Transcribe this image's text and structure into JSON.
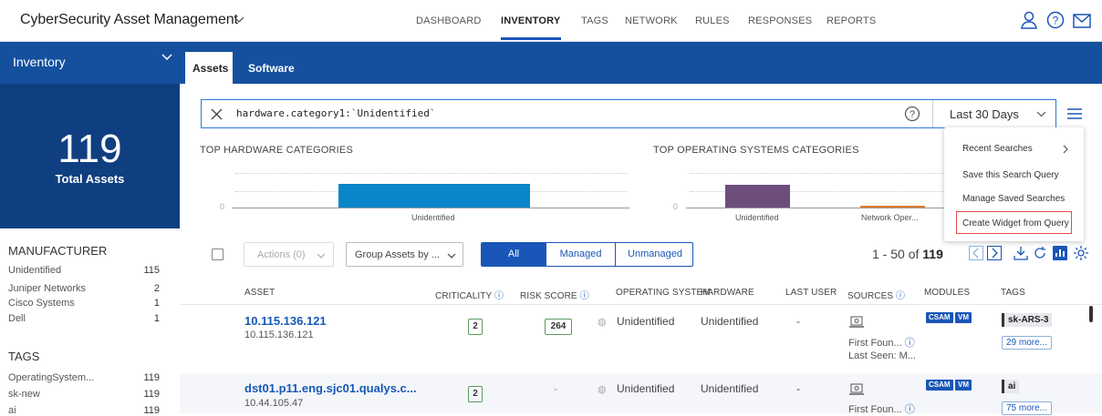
{
  "app": {
    "title": "CyberSecurity Asset Management"
  },
  "nav": {
    "items": [
      "DASHBOARD",
      "INVENTORY",
      "TAGS",
      "NETWORK",
      "RULES",
      "RESPONSES",
      "REPORTS"
    ],
    "active": "INVENTORY"
  },
  "sidebar": {
    "title": "Inventory",
    "total": "119",
    "total_label": "Total Assets",
    "manufacturer_heading": "MANUFACTURER",
    "manufacturers": [
      {
        "name": "Unidentified",
        "count": "115"
      },
      {
        "name": "Juniper Networks",
        "count": "2"
      },
      {
        "name": "Cisco Systems",
        "count": "1"
      },
      {
        "name": "Dell",
        "count": "1"
      }
    ],
    "tags_heading": "TAGS",
    "tags": [
      {
        "name": "OperatingSystem...",
        "count": "119"
      },
      {
        "name": "sk-new",
        "count": "119"
      },
      {
        "name": "ai",
        "count": "119"
      }
    ]
  },
  "tabs": {
    "assets": "Assets",
    "software": "Software"
  },
  "search": {
    "query": "hardware.category1:`Unidentified`",
    "range": "Last 30 Days"
  },
  "charts": {
    "hardware_title": "TOP HARDWARE CATEGORIES",
    "os_title": "TOP OPERATING SYSTEMS CATEGORIES",
    "zero": "0"
  },
  "chart_data": [
    {
      "type": "bar",
      "title": "TOP HARDWARE CATEGORIES",
      "categories": [
        "Unidentified"
      ],
      "values": [
        119
      ]
    },
    {
      "type": "bar",
      "title": "TOP OPERATING SYSTEMS CATEGORIES",
      "categories": [
        "Unidentified",
        "Network Oper..."
      ],
      "values": [
        115,
        4
      ]
    }
  ],
  "menu": {
    "items": [
      "Recent Searches",
      "Save this Search Query",
      "Manage Saved Searches",
      "Create Widget from Query"
    ]
  },
  "toolbar": {
    "actions": "Actions (0)",
    "group_by": "Group Assets by ...",
    "filters": [
      "All",
      "Managed",
      "Unmanaged"
    ],
    "pager_prefix": "1 - 50 of",
    "pager_total": "119"
  },
  "table": {
    "headers": [
      "ASSET",
      "CRITICALITY",
      "RISK SCORE",
      "OPERATING SYSTEM",
      "HARDWARE",
      "LAST USER",
      "SOURCES",
      "MODULES",
      "TAGS"
    ],
    "rows": [
      {
        "name": "10.115.136.121",
        "ip": "10.115.136.121",
        "criticality": "2",
        "risk": "264",
        "os": "Unidentified",
        "hardware": "Unidentified",
        "user": "-",
        "source1": "First Foun...",
        "source2": "Last Seen: M...",
        "modules": [
          "CSAM",
          "VM"
        ],
        "tag": "sk-ARS-3",
        "more": "29 more..."
      },
      {
        "name": "dst01.p11.eng.sjc01.qualys.c...",
        "ip": "10.44.105.47",
        "criticality": "2",
        "risk": "-",
        "os": "Unidentified",
        "hardware": "Unidentified",
        "user": "-",
        "source1": "First Foun...",
        "modules": [
          "CSAM",
          "VM"
        ],
        "tag": "ai",
        "more": "75 more..."
      }
    ]
  },
  "colors": {
    "primary": "#15509e",
    "dark": "#0f3f81",
    "hw_bar": "#0a85c9",
    "os_bar1": "#6d4d7c",
    "os_bar2": "#e07b2a"
  }
}
